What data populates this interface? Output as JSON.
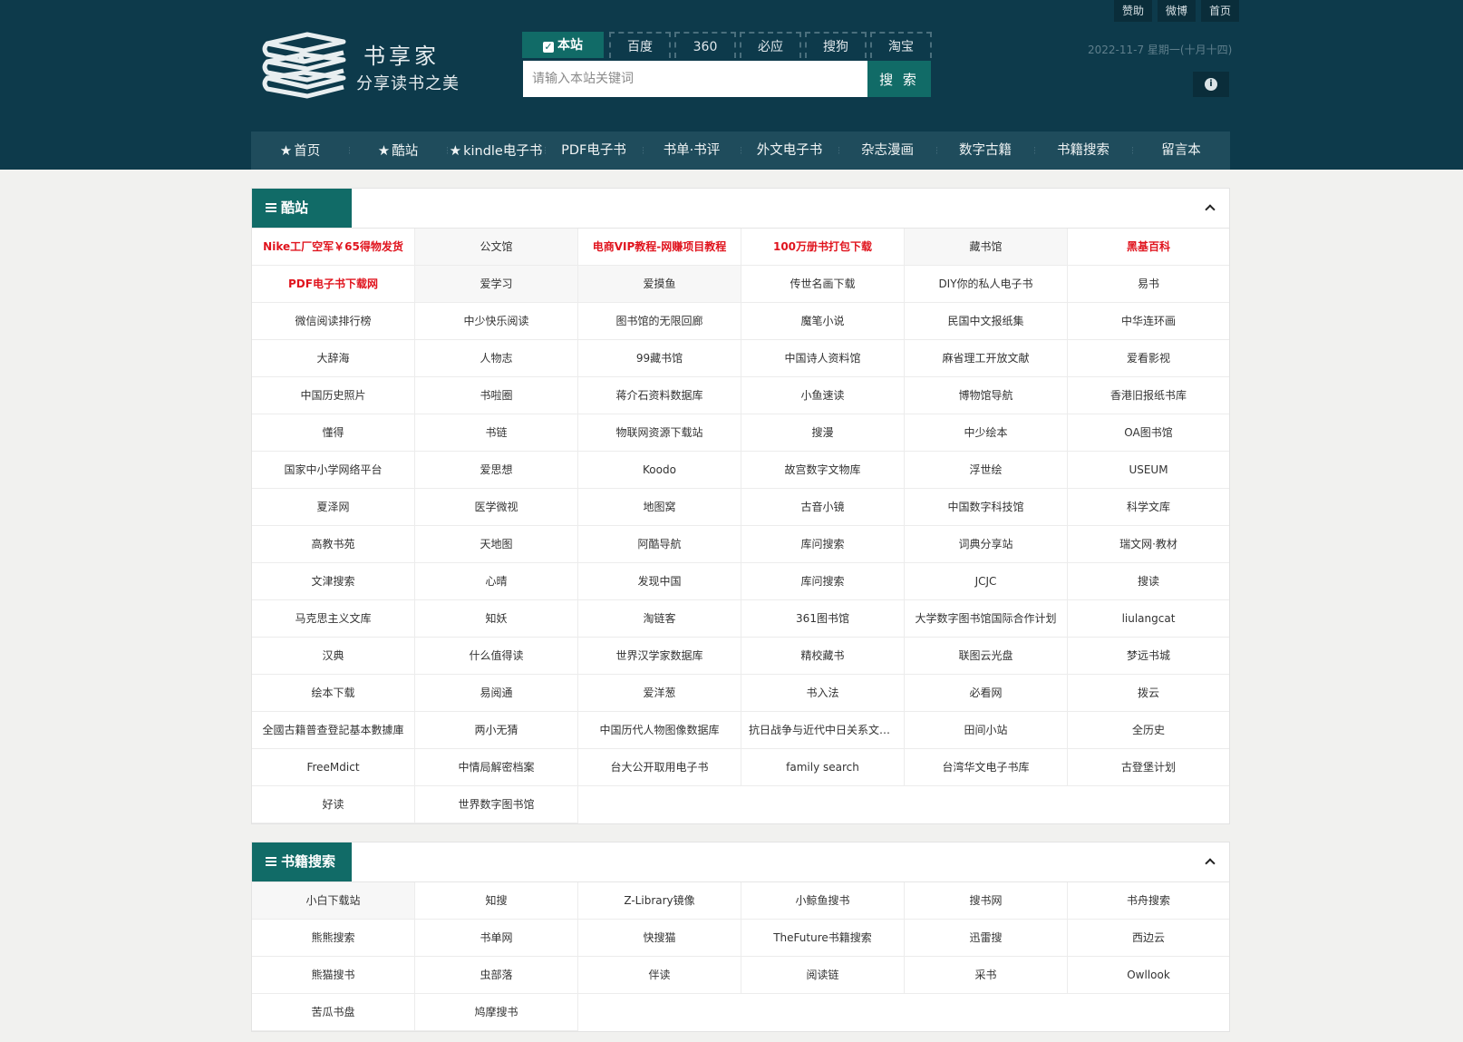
{
  "top_links": [
    "赞助",
    "微博",
    "首页"
  ],
  "logo": {
    "title": "书享家",
    "subtitle": "分享读书之美"
  },
  "search": {
    "engines": [
      "本站",
      "百度",
      "360",
      "必应",
      "搜狗",
      "淘宝"
    ],
    "active_engine": "本站",
    "placeholder": "请输入本站关键词",
    "button": "搜 索"
  },
  "date": "2022-11-7  星期一(十月十四)",
  "nav": [
    {
      "label": "首页",
      "star": true
    },
    {
      "label": "酷站",
      "star": true
    },
    {
      "label": "kindle电子书",
      "star": true
    },
    {
      "label": "PDF电子书",
      "star": false
    },
    {
      "label": "书单·书评",
      "star": false
    },
    {
      "label": "外文电子书",
      "star": false
    },
    {
      "label": "杂志漫画",
      "star": false
    },
    {
      "label": "数字古籍",
      "star": false
    },
    {
      "label": "书籍搜索",
      "star": false
    },
    {
      "label": "留言本",
      "star": false
    }
  ],
  "sections": [
    {
      "title": "酷站",
      "items": [
        {
          "label": "Nike工厂空军￥65得物发货",
          "hl": true
        },
        {
          "label": "公文馆"
        },
        {
          "label": "电商VIP教程-网赚项目教程",
          "hl": true
        },
        {
          "label": "100万册书打包下载",
          "hl": true
        },
        {
          "label": "藏书馆"
        },
        {
          "label": "黑基百科",
          "hl": true
        },
        {
          "label": "PDF电子书下载网",
          "hl": true
        },
        {
          "label": "爱学习"
        },
        {
          "label": "爱摸鱼"
        },
        {
          "label": "传世名画下载"
        },
        {
          "label": "DIY你的私人电子书"
        },
        {
          "label": "易书"
        },
        {
          "label": "微信阅读排行榜"
        },
        {
          "label": "中少快乐阅读"
        },
        {
          "label": "图书馆的无限回廊"
        },
        {
          "label": "魔笔小说"
        },
        {
          "label": "民国中文报纸集"
        },
        {
          "label": "中华连环画"
        },
        {
          "label": "大辞海"
        },
        {
          "label": "人物志"
        },
        {
          "label": "99藏书馆"
        },
        {
          "label": "中国诗人资料馆"
        },
        {
          "label": "麻省理工开放文献"
        },
        {
          "label": "爱看影视"
        },
        {
          "label": "中国历史照片"
        },
        {
          "label": "书啦圈"
        },
        {
          "label": "蒋介石资料数据库"
        },
        {
          "label": "小鱼速读"
        },
        {
          "label": "博物馆导航"
        },
        {
          "label": "香港旧报纸书库"
        },
        {
          "label": "懂得"
        },
        {
          "label": "书链"
        },
        {
          "label": "物联网资源下载站"
        },
        {
          "label": "搜漫"
        },
        {
          "label": "中少绘本"
        },
        {
          "label": "OA图书馆"
        },
        {
          "label": "国家中小学网络平台"
        },
        {
          "label": "爱思想"
        },
        {
          "label": "Koodo"
        },
        {
          "label": "故宫数字文物库"
        },
        {
          "label": "浮世绘"
        },
        {
          "label": "USEUM"
        },
        {
          "label": "夏泽网"
        },
        {
          "label": "医学微视"
        },
        {
          "label": "地图窝"
        },
        {
          "label": "古音小镜"
        },
        {
          "label": "中国数字科技馆"
        },
        {
          "label": "科学文库"
        },
        {
          "label": "高教书苑"
        },
        {
          "label": "天地图"
        },
        {
          "label": "阿酷导航"
        },
        {
          "label": "库问搜索"
        },
        {
          "label": "词典分享站"
        },
        {
          "label": "瑞文网·教材"
        },
        {
          "label": "文津搜索"
        },
        {
          "label": "心晴"
        },
        {
          "label": "发现中国"
        },
        {
          "label": "库问搜索"
        },
        {
          "label": "JCJC"
        },
        {
          "label": "搜读"
        },
        {
          "label": "马克思主义文库"
        },
        {
          "label": "知妖"
        },
        {
          "label": "淘链客"
        },
        {
          "label": "361图书馆"
        },
        {
          "label": "大学数字图书馆国际合作计划"
        },
        {
          "label": "liulangcat"
        },
        {
          "label": "汉典"
        },
        {
          "label": "什么值得读"
        },
        {
          "label": "世界汉学家数据库"
        },
        {
          "label": "精校藏书"
        },
        {
          "label": "联图云光盘"
        },
        {
          "label": "梦远书城"
        },
        {
          "label": "绘本下载"
        },
        {
          "label": "易阅通"
        },
        {
          "label": "爱洋葱"
        },
        {
          "label": "书入法"
        },
        {
          "label": "必看网"
        },
        {
          "label": "拨云"
        },
        {
          "label": "全國古籍普查登記基本數據庫"
        },
        {
          "label": "两小无猜"
        },
        {
          "label": "中国历代人物图像数据库"
        },
        {
          "label": "抗日战争与近代中日关系文献数据平台"
        },
        {
          "label": "田间小站"
        },
        {
          "label": "全历史"
        },
        {
          "label": "FreeMdict"
        },
        {
          "label": "中情局解密档案"
        },
        {
          "label": "台大公开取用电子书"
        },
        {
          "label": "family search"
        },
        {
          "label": "台湾华文电子书库"
        },
        {
          "label": "古登堡计划"
        },
        {
          "label": "好读"
        },
        {
          "label": "世界数字图书馆"
        }
      ]
    },
    {
      "title": "书籍搜索",
      "items": [
        {
          "label": "小白下载站"
        },
        {
          "label": "知搜"
        },
        {
          "label": "Z-Library镜像"
        },
        {
          "label": "小鲸鱼搜书"
        },
        {
          "label": "搜书网"
        },
        {
          "label": "书舟搜索"
        },
        {
          "label": "熊熊搜索"
        },
        {
          "label": "书单网"
        },
        {
          "label": "快搜猫"
        },
        {
          "label": "TheFuture书籍搜索"
        },
        {
          "label": "迅雷搜"
        },
        {
          "label": "西边云"
        },
        {
          "label": "熊猫搜书"
        },
        {
          "label": "虫部落"
        },
        {
          "label": "伴读"
        },
        {
          "label": "阅读链"
        },
        {
          "label": "采书"
        },
        {
          "label": "Owllook"
        },
        {
          "label": "苦瓜书盘"
        },
        {
          "label": "鸠摩搜书"
        }
      ]
    }
  ]
}
